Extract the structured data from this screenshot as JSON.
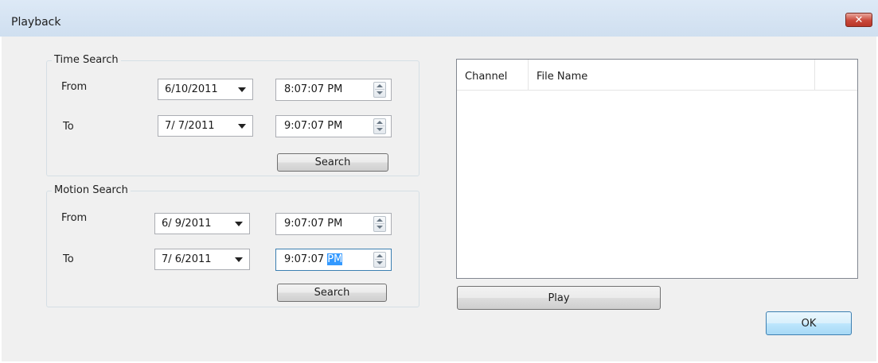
{
  "window": {
    "title": "Playback",
    "close_symbol": "✕"
  },
  "time_search": {
    "group_label": "Time Search",
    "from_label": "From",
    "to_label": "To",
    "from_date": "6/10/2011",
    "from_time": "8:07:07 PM",
    "to_date": "7/ 7/2011",
    "to_time": "9:07:07 PM",
    "search_label": "Search"
  },
  "motion_search": {
    "group_label": "Motion Search",
    "from_label": "From",
    "to_label": "To",
    "from_date": "6/ 9/2011",
    "from_time": "9:07:07 PM",
    "to_date": "7/ 6/2011",
    "to_time_main": "9:07:07 ",
    "to_time_selected": "PM",
    "search_label": "Search"
  },
  "file_list": {
    "columns": [
      "Channel",
      "File Name"
    ],
    "rows": []
  },
  "play_label": "Play",
  "ok_label": "OK",
  "icons": {
    "date_dropdown": "chevron-down-icon",
    "time_spinner": "spinner-icon",
    "close": "close-icon"
  }
}
